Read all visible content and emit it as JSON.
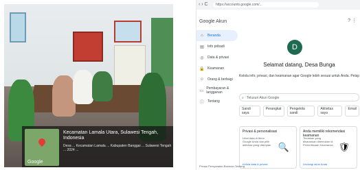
{
  "photo": {
    "geo": {
      "title": "Kecamatan Lamala Utara, Sulawesi Tengah, Indonesia",
      "lines": "Desa ... Kecamatan Lamala ... Kabupaten Banggai ... Sulawesi Tengah ... 2024 ...",
      "google": "Google"
    }
  },
  "browser": {
    "nav": "‹ › C",
    "url": "https://accounts.google.com/...",
    "brand": "Google Akun",
    "top_icons": "? ⋮ ",
    "sidebar": [
      {
        "icon": "home-icon",
        "glyph": "⌂",
        "label": "Beranda",
        "active": true
      },
      {
        "icon": "id-icon",
        "glyph": "▤",
        "label": "Info pribadi"
      },
      {
        "icon": "data-icon",
        "glyph": "◎",
        "label": "Data & privasi"
      },
      {
        "icon": "security-icon",
        "glyph": "🔒",
        "label": "Keamanan"
      },
      {
        "icon": "people-icon",
        "glyph": "☺",
        "label": "Orang & berbagi"
      },
      {
        "icon": "payment-icon",
        "glyph": "▭",
        "label": "Pembayaran & langganan"
      },
      {
        "icon": "info-icon",
        "glyph": "ⓘ",
        "label": "Tentang"
      }
    ],
    "main": {
      "avatar": "D",
      "welcome": "Selamat datang, Desa Bunga",
      "subtitle": "Kelola info, privasi, dan keamanan agar Google lebih sesuai untuk Anda. Pelajari lebih lanjut",
      "search_placeholder": "Telusuri Akun Google",
      "chips": [
        "Sandi saya",
        "Perangkat",
        "Pengelola sandi",
        "Aktivitas saya",
        "Email"
      ],
      "cards": [
        {
          "title": "Privasi & personalisasi",
          "desc": "Lihat data di Akun Google Anda dan pilih aktivitas yang disimpan",
          "link": "Kelola data & privasi",
          "icon": "privacy-icon",
          "glyph": "🔍"
        },
        {
          "title": "Anda memiliki rekomendasi keamanan",
          "desc": "Tindakan yang disarankan ditemukan di Pemeriksaan Keamanan",
          "link": "Lindungi akun Anda",
          "icon": "shield-icon",
          "glyph": "🛡"
        }
      ]
    },
    "footer": "Privasi   Persyaratan   Bantuan   Tentang"
  }
}
